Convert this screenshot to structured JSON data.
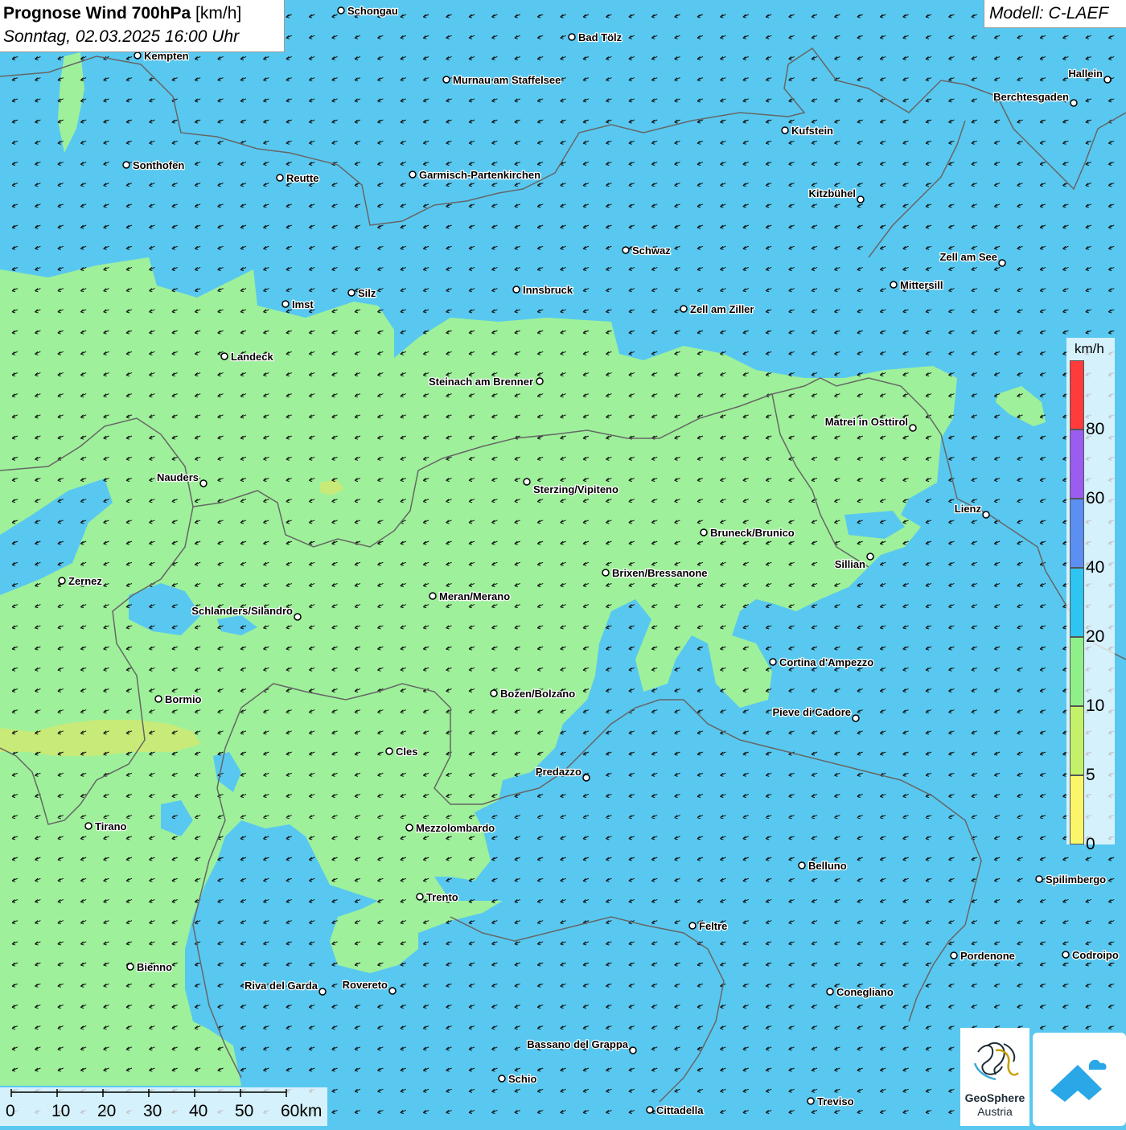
{
  "title": {
    "main": "Prognose Wind 700hPa",
    "unit": "[km/h]",
    "datetime": "Sonntag, 02.03.2025 16:00 Uhr"
  },
  "model": "Modell: C-LAEF",
  "colors": {
    "ocean_blue": "#59c8f0",
    "light_green": "#9ef19a",
    "yellow_green": "#c8ea78",
    "border": "#666666",
    "arrow": "#111111"
  },
  "wind_direction": "arrows pointing west-south-west across the map",
  "legend": {
    "unit": "km/h",
    "labels": [
      "80",
      "60",
      "40",
      "20",
      "10",
      "5",
      "0"
    ],
    "segments": [
      {
        "color": "#ff3b3b"
      },
      {
        "color": "#9b5cf0"
      },
      {
        "color": "#5b8ff2"
      },
      {
        "color": "#2ec5f2"
      },
      {
        "color": "#8ff08a"
      },
      {
        "color": "#c3f26a"
      },
      {
        "color": "#fbf56a"
      }
    ]
  },
  "scale_bar": {
    "labels": [
      "0",
      "10",
      "20",
      "30",
      "40",
      "50",
      "60km"
    ]
  },
  "cities": [
    {
      "name": "Schongau"
    },
    {
      "name": "Bad Tölz"
    },
    {
      "name": "Kempten"
    },
    {
      "name": "Murnau am Staffelsee"
    },
    {
      "name": "Hallein"
    },
    {
      "name": "Berchtesgaden"
    },
    {
      "name": "Kufstein"
    },
    {
      "name": "Sonthofen"
    },
    {
      "name": "Reutte"
    },
    {
      "name": "Garmisch-Partenkirchen"
    },
    {
      "name": "Kitzbühel"
    },
    {
      "name": "Schwaz"
    },
    {
      "name": "Zell am See"
    },
    {
      "name": "Mittersill"
    },
    {
      "name": "Innsbruck"
    },
    {
      "name": "Silz"
    },
    {
      "name": "Imst"
    },
    {
      "name": "Zell am Ziller"
    },
    {
      "name": "Landeck"
    },
    {
      "name": "Steinach am Brenner"
    },
    {
      "name": "Matrei in Osttirol"
    },
    {
      "name": "Nauders"
    },
    {
      "name": "Sterzing/Vipiteno"
    },
    {
      "name": "Lienz"
    },
    {
      "name": "Bruneck/Brunico"
    },
    {
      "name": "Sillian"
    },
    {
      "name": "Zernez"
    },
    {
      "name": "Brixen/Bressanone"
    },
    {
      "name": "Meran/Merano"
    },
    {
      "name": "Schlanders/Silandro"
    },
    {
      "name": "Cortina d'Ampezzo"
    },
    {
      "name": "Bozen/Bolzano"
    },
    {
      "name": "Bormio"
    },
    {
      "name": "Pieve di Cadore"
    },
    {
      "name": "Cles"
    },
    {
      "name": "Predazzo"
    },
    {
      "name": "Tirano"
    },
    {
      "name": "Mezzolombardo"
    },
    {
      "name": "Belluno"
    },
    {
      "name": "Spilimbergo"
    },
    {
      "name": "Trento"
    },
    {
      "name": "Feltre"
    },
    {
      "name": "Pordenone"
    },
    {
      "name": "Codroipo"
    },
    {
      "name": "Bienno"
    },
    {
      "name": "Riva del Garda"
    },
    {
      "name": "Rovereto"
    },
    {
      "name": "Conegliano"
    },
    {
      "name": "Bassano del Grappa"
    },
    {
      "name": "Schio"
    },
    {
      "name": "Treviso"
    },
    {
      "name": "Cittadella"
    }
  ],
  "logo": {
    "name": "GeoSphere",
    "sub": "Austria"
  }
}
